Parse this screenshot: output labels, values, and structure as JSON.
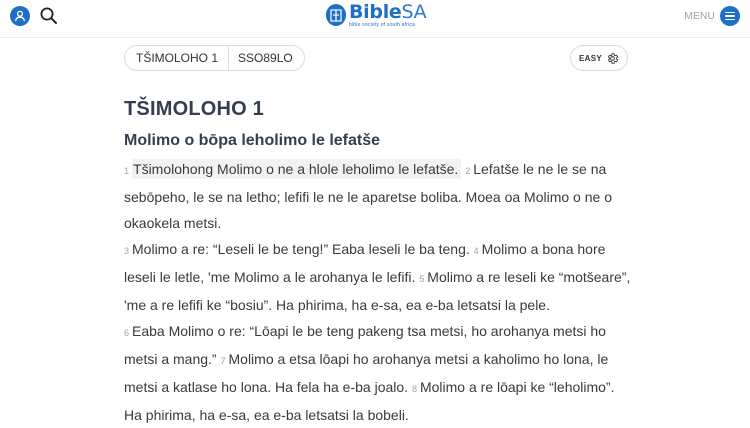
{
  "header": {
    "logo_name_bible": "Bible",
    "logo_name_sa": "SA",
    "logo_tagline": "bible society of south africa",
    "menu_label": "MENU",
    "icons": {
      "user": "user-icon",
      "search": "search-icon",
      "menu": "hamburger-icon"
    },
    "accent_color": "#1f6fc6"
  },
  "toolbar": {
    "book_chapter": "TŠIMOLOHO 1",
    "version": "SSO89LO",
    "easy_label": "EASY",
    "settings_icon": "gear-icon"
  },
  "content": {
    "chapter_title": "TŠIMOLOHO 1",
    "section_title": "Molimo o bōpa leholimo le lefatše",
    "verses": [
      {
        "num": "1",
        "text": "Tšimolohong Molimo o ne a hlole leholimo le lefatše."
      },
      {
        "num": "2",
        "text": "Lefatše le ne le se na sebōpeho, le se na letho; lefifi le ne le aparetse boliba. Moea oa Molimo o ne o okaokela metsi."
      },
      {
        "num": "3",
        "text": "Molimo a re: “Leseli le be teng!” Eaba leseli le ba teng."
      },
      {
        "num": "4",
        "text": "Molimo a bona hore leseli le letle, 'me Molimo a le arohanya le lefifi."
      },
      {
        "num": "5",
        "text": "Molimo a re leseli ke “motšeare”, 'me a re lefifi ke “bosiu”. Ha phirima, ha e-sa, ea e-ba letsatsi la pele."
      },
      {
        "num": "6",
        "text": "Eaba Molimo o re: “Lōapi le be teng pakeng tsa metsi, ho arohanya metsi ho metsi a mang.”"
      },
      {
        "num": "7",
        "text": "Molimo a etsa lōapi ho arohanya metsi a kaholimo ho lona, le metsi a katlase ho lona. Ha fela ha e-ba joalo."
      },
      {
        "num": "8",
        "text": "Molimo a re lōapi ke “leholimo”. Ha phirima, ha e-sa, ea e-ba letsatsi la bobeli."
      }
    ]
  }
}
